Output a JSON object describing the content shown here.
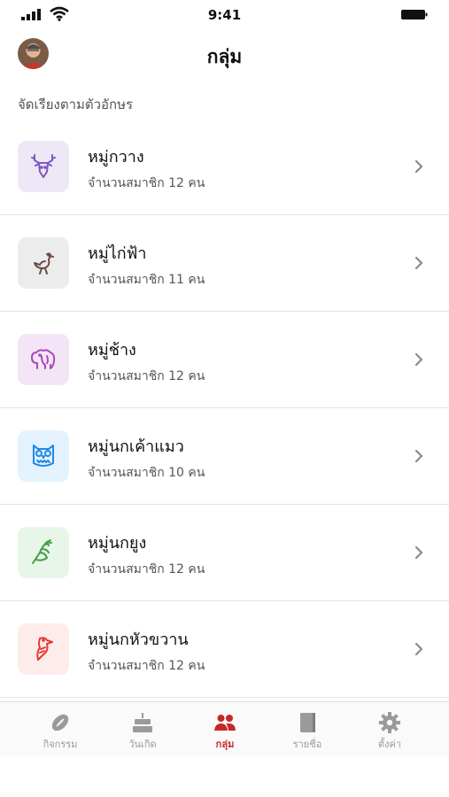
{
  "status_bar": {
    "time": "9:41"
  },
  "header": {
    "title": "กลุ่ม"
  },
  "sort_label": "จัดเรียงตามตัวอักษร",
  "groups": [
    {
      "name": "หมู่กวาง",
      "count": "จำนวนสมาชิก 12 คน",
      "icon": "deer-icon",
      "color": "#7e57c2",
      "bg": "#ede7f6"
    },
    {
      "name": "หมู่ไก่ฟ้า",
      "count": "จำนวนสมาชิก 11 คน",
      "icon": "pheasant-icon",
      "color": "#6d4c41",
      "bg": "#ececec"
    },
    {
      "name": "หมู่ช้าง",
      "count": "จำนวนสมาชิก 12 คน",
      "icon": "elephant-icon",
      "color": "#ab47bc",
      "bg": "#f3e5f5"
    },
    {
      "name": "หมู่นกเค้าแมว",
      "count": "จำนวนสมาชิก 10 คน",
      "icon": "owl-icon",
      "color": "#1e88e5",
      "bg": "#e3f2fd"
    },
    {
      "name": "หมู่นกยูง",
      "count": "จำนวนสมาชิก 12 คน",
      "icon": "peacock-icon",
      "color": "#43a047",
      "bg": "#e8f5e9"
    },
    {
      "name": "หมู่นกหัวขวาน",
      "count": "จำนวนสมาชิก 12 คน",
      "icon": "woodpecker-icon",
      "color": "#e53935",
      "bg": "#fdecea"
    }
  ],
  "tabs": [
    {
      "label": "กิจกรรม",
      "icon": "football-icon",
      "active": false
    },
    {
      "label": "วันเกิด",
      "icon": "cake-icon",
      "active": false
    },
    {
      "label": "กลุ่ม",
      "icon": "people-icon",
      "active": true
    },
    {
      "label": "รายชื่อ",
      "icon": "book-icon",
      "active": false
    },
    {
      "label": "ตั้งค่า",
      "icon": "gear-icon",
      "active": false
    }
  ],
  "colors": {
    "accent": "#c62828",
    "inactive": "#9a9a9a",
    "chevron": "#8a8a8a"
  }
}
